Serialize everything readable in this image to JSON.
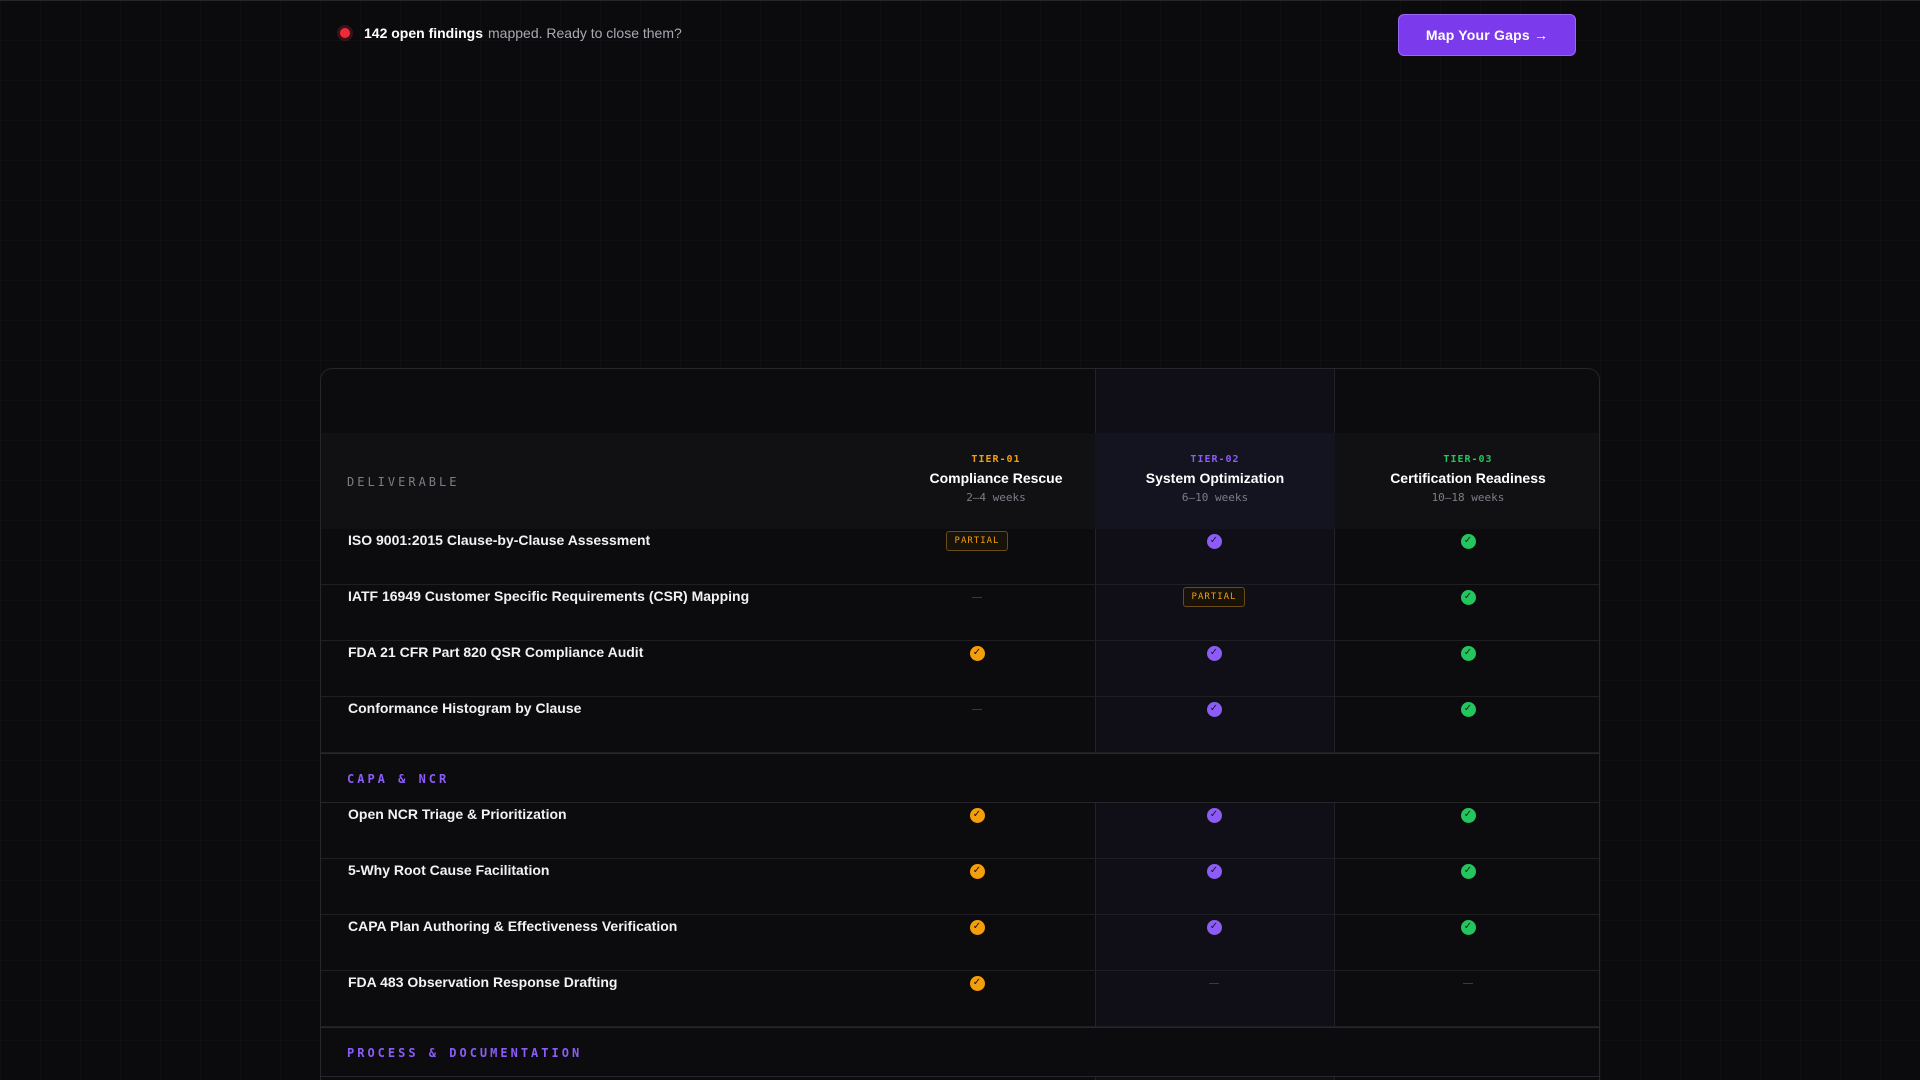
{
  "banner": {
    "findings_strong": "142 open findings",
    "findings_rest": "mapped. Ready to close them?",
    "cta_label": "Map Your Gaps →"
  },
  "table": {
    "deliverable_header": "DELIVERABLE",
    "tiers": [
      {
        "code": "TIER-01",
        "name": "Compliance Rescue",
        "duration": "2–4 weeks",
        "color": "#f59e0b"
      },
      {
        "code": "TIER-02",
        "name": "System Optimization",
        "duration": "6–10 weeks",
        "color": "#8b5cf6"
      },
      {
        "code": "TIER-03",
        "name": "Certification Readiness",
        "duration": "10–18 weeks",
        "color": "#22c55e"
      }
    ],
    "partial_label": "PARTIAL",
    "sections": [
      {
        "title": "",
        "rows": [
          {
            "label": "ISO 9001:2015 Clause-by-Clause Assessment",
            "cells": [
              "partial",
              "check",
              "check"
            ]
          },
          {
            "label": "IATF 16949 Customer Specific Requirements (CSR) Mapping",
            "cells": [
              "none",
              "partial",
              "check"
            ]
          },
          {
            "label": "FDA 21 CFR Part 820 QSR Compliance Audit",
            "cells": [
              "check",
              "check",
              "check"
            ]
          },
          {
            "label": "Conformance Histogram by Clause",
            "cells": [
              "none",
              "check",
              "check"
            ]
          }
        ]
      },
      {
        "title": "CAPA & NCR",
        "rows": [
          {
            "label": "Open NCR Triage & Prioritization",
            "cells": [
              "check",
              "check",
              "check"
            ]
          },
          {
            "label": "5-Why Root Cause Facilitation",
            "cells": [
              "check",
              "check",
              "check"
            ]
          },
          {
            "label": "CAPA Plan Authoring & Effectiveness Verification",
            "cells": [
              "check",
              "check",
              "check"
            ]
          },
          {
            "label": "FDA 483 Observation Response Drafting",
            "cells": [
              "check",
              "none",
              "none"
            ]
          }
        ]
      },
      {
        "title": "PROCESS & DOCUMENTATION",
        "rows": []
      }
    ]
  }
}
